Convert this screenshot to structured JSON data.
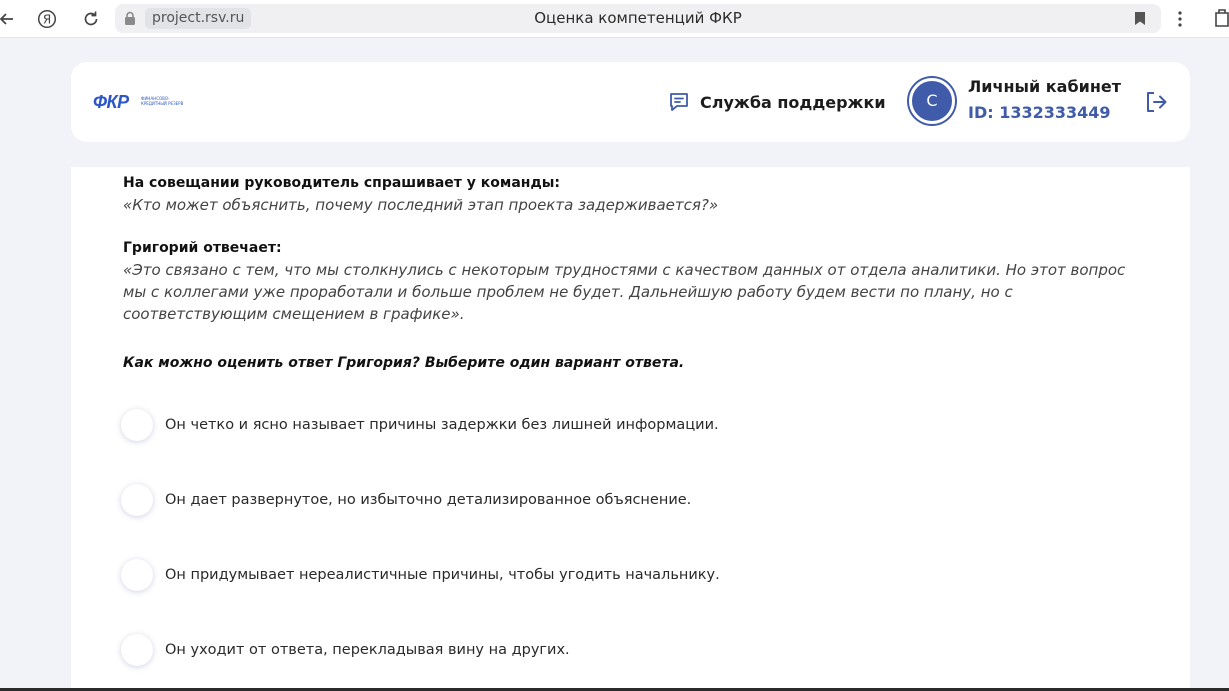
{
  "browser": {
    "url": "project.rsv.ru",
    "tab_title": "Оценка компетенций ФКР",
    "yandex_glyph": "Я"
  },
  "header": {
    "logo_text": "ФКР",
    "logo_subtext": "ФИНАНСОВО-КРЕДИТНЫЙ РЕЗЕРВ",
    "support_label": "Служба поддержки",
    "avatar_letter": "С",
    "cabinet_title": "Личный кабинет",
    "cabinet_id": "ID: 1332333449"
  },
  "content": {
    "prompt_label": "На совещании руководитель спрашивает у команды:",
    "prompt_quote": "«Кто может объяснить, почему последний этап проекта задерживается?»",
    "answer_label": "Григорий отвечает:",
    "answer_quote": "«Это связано с тем, что мы столкнулись с некоторым трудностями с качеством данных от отдела аналитики. Но этот вопрос мы с коллегами уже проработали и больше проблем не будет. Дальнейшую работу будем вести по плану, но с соответствующим смещением в графике».",
    "question": "Как можно оценить ответ Григория? Выберите один вариант ответа.",
    "options": [
      "Он четко и ясно называет причины задержки без лишней информации.",
      "Он дает развернутое, но избыточно детализированное объяснение.",
      "Он придумывает нереалистичные причины, чтобы угодить начальнику.",
      "Он уходит от ответа, перекладывая вину на других."
    ]
  },
  "colors": {
    "accent": "#3f5ba9",
    "logo_blue": "#2d57c8",
    "page_bg": "#f1f3f8"
  },
  "icons": [
    "back-arrow-icon",
    "yandex-icon",
    "reload-icon",
    "lock-icon",
    "bookmark-icon",
    "menu-dots-icon",
    "chat-icon",
    "logout-icon"
  ]
}
